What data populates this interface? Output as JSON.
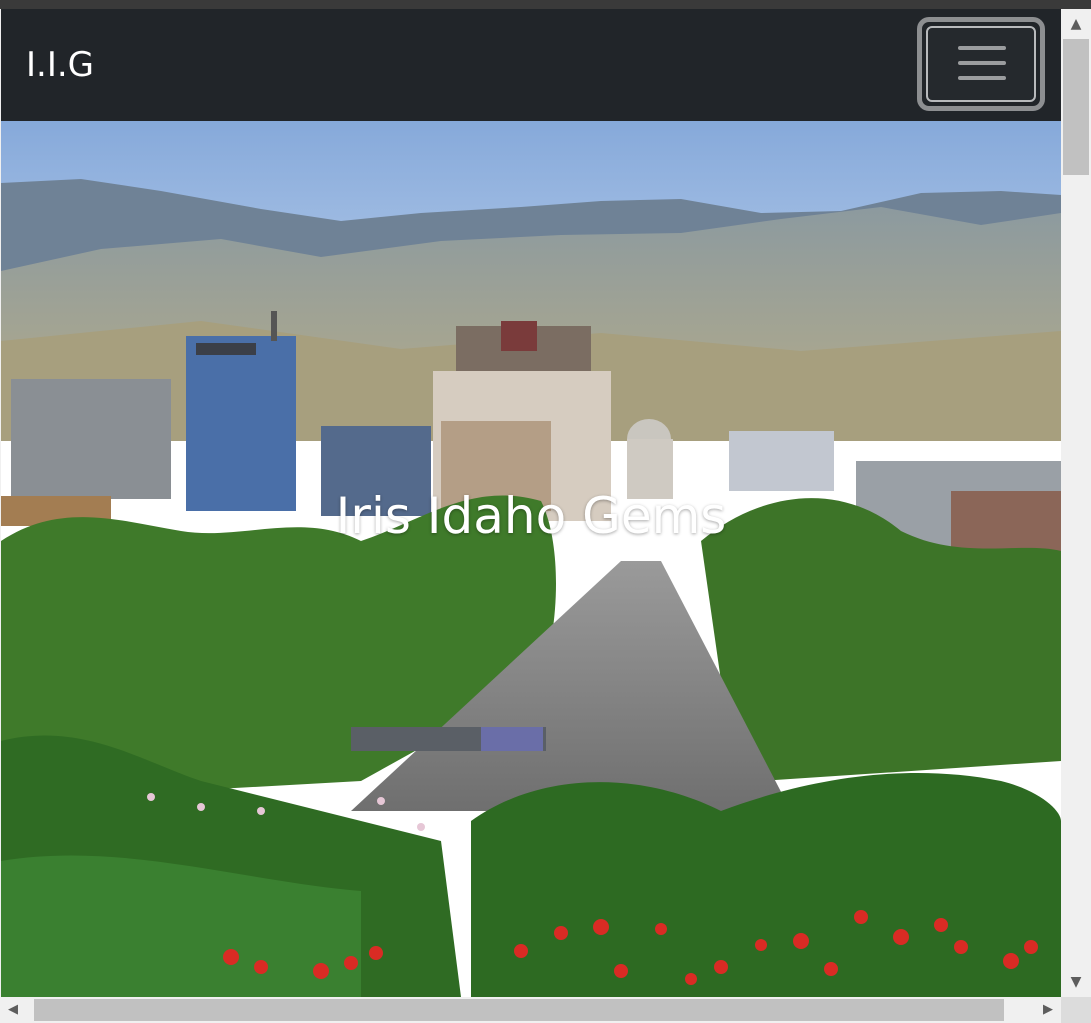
{
  "navbar": {
    "brand": "I.I.G",
    "toggler_icon": "hamburger-menu-icon"
  },
  "hero": {
    "title": "Iris Idaho Gems",
    "image_alt": "Boise, Idaho downtown skyline with foothills, capitol dome, tree-lined avenue and red flowers"
  },
  "scrollbars": {
    "up_arrow": "▲",
    "down_arrow": "▼",
    "left_arrow": "◀",
    "right_arrow": "▶"
  },
  "colors": {
    "navbar_bg": "#212529",
    "brand_text": "#ffffff",
    "toggler_border": "#8d8f91",
    "sky": "#8eb1e0"
  }
}
